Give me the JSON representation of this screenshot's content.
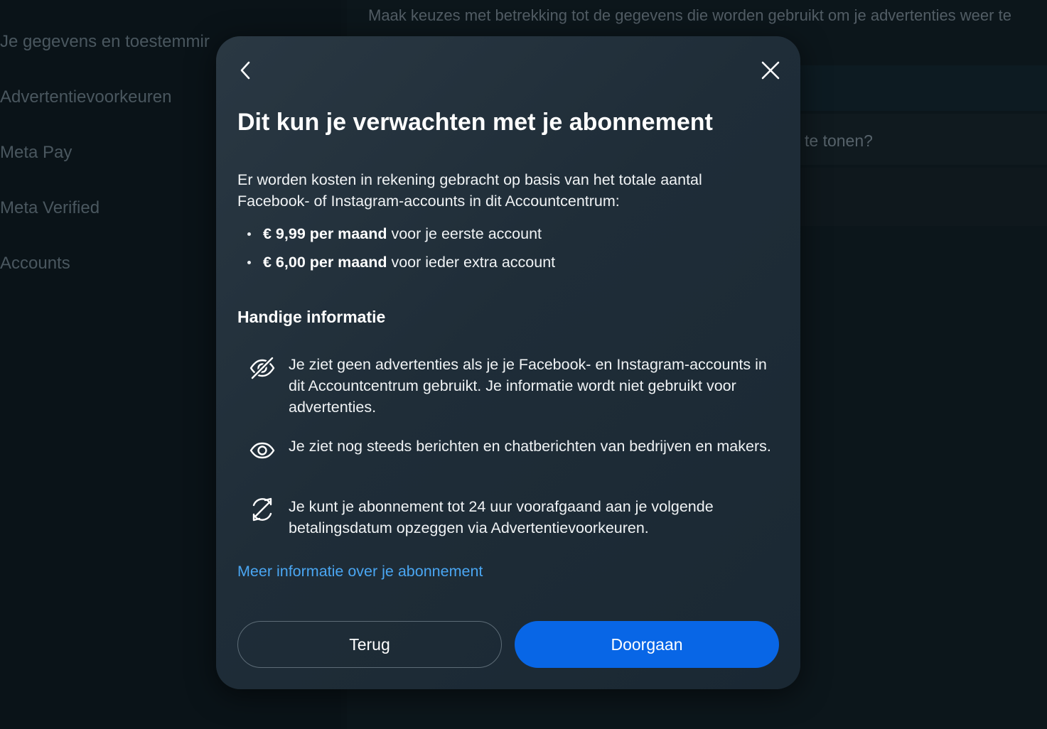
{
  "background": {
    "nav_items": [
      {
        "label": "Je gegevens en toestemmir"
      },
      {
        "label": "Advertentievoorkeuren"
      },
      {
        "label": "Meta Pay"
      },
      {
        "label": "Meta Verified"
      },
      {
        "label": "Accounts"
      }
    ],
    "description": "Maak keuzes met betrekking tot de gegevens die worden gebruikt om je advertenties weer te geven",
    "question_fragment": "te tonen?"
  },
  "modal": {
    "title": "Dit kun je verwachten met je abonnement",
    "intro": "Er worden kosten in rekening gebracht op basis van het totale aantal Facebook- of Instagram-accounts in dit Accountcentrum:",
    "prices": [
      {
        "price": "€ 9,99 per maand",
        "rest": "voor je eerste account"
      },
      {
        "price": "€ 6,00 per maand",
        "rest": "voor ieder extra account"
      }
    ],
    "section_title": "Handige informatie",
    "info": [
      {
        "icon": "eye-slash-icon",
        "text": "Je ziet geen advertenties als je je Facebook- en Instagram-accounts in dit Accountcentrum gebruikt. Je informatie wordt niet gebruikt voor advertenties."
      },
      {
        "icon": "eye-icon",
        "text": "Je ziet nog steeds berichten en chatberichten van bedrijven en makers."
      },
      {
        "icon": "cancel-cycle-icon",
        "text": "Je kunt je abonnement tot 24 uur voorafgaand aan je volgende betalingsdatum opzeggen via Advertentievoorkeuren."
      }
    ],
    "more_link": "Meer informatie over je abonnement",
    "back_button": "Terug",
    "continue_button": "Doorgaan"
  },
  "colors": {
    "page_bg": "#0b1419",
    "modal_bg": "#22303b",
    "accent": "#0866e6",
    "link": "#4aa6f2"
  }
}
